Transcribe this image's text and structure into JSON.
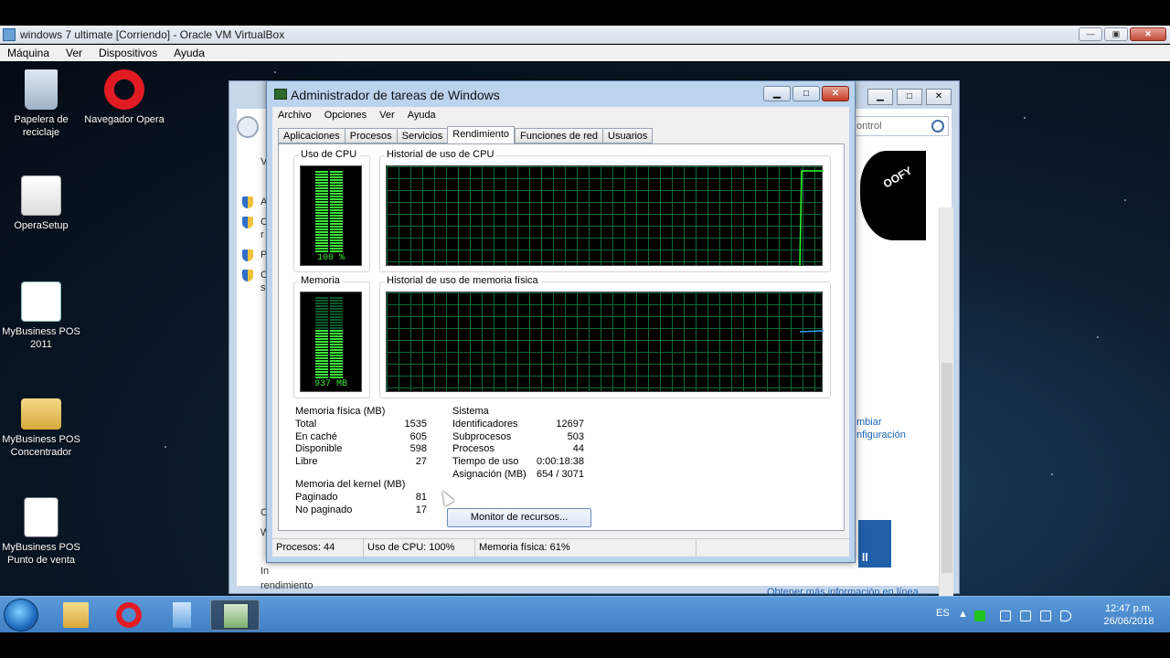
{
  "host": {
    "title": "windows 7 ultimate [Corriendo] - Oracle VM VirtualBox",
    "menu": [
      "Máquina",
      "Ver",
      "Dispositivos",
      "Ayuda"
    ],
    "controls": [
      "—",
      "▣",
      "✕"
    ]
  },
  "desktop_icons": [
    {
      "label": "Papelera de reciclaje",
      "icon": "recycle-bin-icon"
    },
    {
      "label": "Navegador Opera",
      "icon": "opera-icon"
    },
    {
      "label": "OperaSetup",
      "icon": "opera-setup-icon"
    },
    {
      "label": "MyBusiness POS 2011",
      "icon": "mybusiness-icon"
    },
    {
      "label": "MyBusiness POS Concentrador",
      "icon": "folder-icon"
    },
    {
      "label": "MyBusiness POS Punto de venta",
      "icon": "document-icon"
    }
  ],
  "background_window": {
    "search_placeholder": "ontrol",
    "links": [
      "mbiar",
      "nfiguración"
    ],
    "more_info": "Obtener más información en línea...",
    "footer": "rendimiento",
    "poster_text": "OOFY",
    "left_fragments": [
      "V",
      "A",
      "C",
      "r",
      "P",
      "C",
      "s",
      "C",
      "W",
      "In"
    ],
    "badge_text": "ll"
  },
  "taskmgr": {
    "title": "Administrador de tareas de Windows",
    "controls": [
      "▁",
      "□",
      "✕"
    ],
    "menu": [
      "Archivo",
      "Opciones",
      "Ver",
      "Ayuda"
    ],
    "tabs": [
      "Aplicaciones",
      "Procesos",
      "Servicios",
      "Rendimiento",
      "Funciones de red",
      "Usuarios"
    ],
    "active_tab": "Rendimiento",
    "cpu_label": "Uso de CPU",
    "cpu_value": "100 %",
    "cpu_usage_fraction": 1.0,
    "cpu_history_label": "Historial de uso de CPU",
    "mem_label": "Memoria",
    "mem_value": "937 MB",
    "mem_usage_fraction": 0.61,
    "mem_history_label": "Historial de uso de memoria física",
    "physical": {
      "title": "Memoria física (MB)",
      "rows": [
        {
          "k": "Total",
          "v": "1535"
        },
        {
          "k": "En caché",
          "v": "605"
        },
        {
          "k": "Disponible",
          "v": "598"
        },
        {
          "k": "Libre",
          "v": "27"
        }
      ]
    },
    "kernel": {
      "title": "Memoria del kernel (MB)",
      "rows": [
        {
          "k": "Paginado",
          "v": "81"
        },
        {
          "k": "No paginado",
          "v": "17"
        }
      ]
    },
    "system": {
      "title": "Sistema",
      "rows": [
        {
          "k": "Identificadores",
          "v": "12697"
        },
        {
          "k": "Subprocesos",
          "v": "503"
        },
        {
          "k": "Procesos",
          "v": "44"
        },
        {
          "k": "Tiempo de uso",
          "v": "0:00:18:38"
        },
        {
          "k": "Asignación (MB)",
          "v": "654 / 3071"
        }
      ]
    },
    "resource_monitor_button": "Monitor de recursos...",
    "status": {
      "processes": "Procesos: 44",
      "cpu": "Uso de CPU: 100%",
      "memory": "Memoria física: 61%"
    }
  },
  "taskbar": {
    "language": "ES",
    "time": "12:47 p.m.",
    "date": "26/06/2018",
    "pinned": [
      "explorer-icon",
      "opera-icon",
      "control-panel-icon",
      "task-manager-icon"
    ]
  }
}
